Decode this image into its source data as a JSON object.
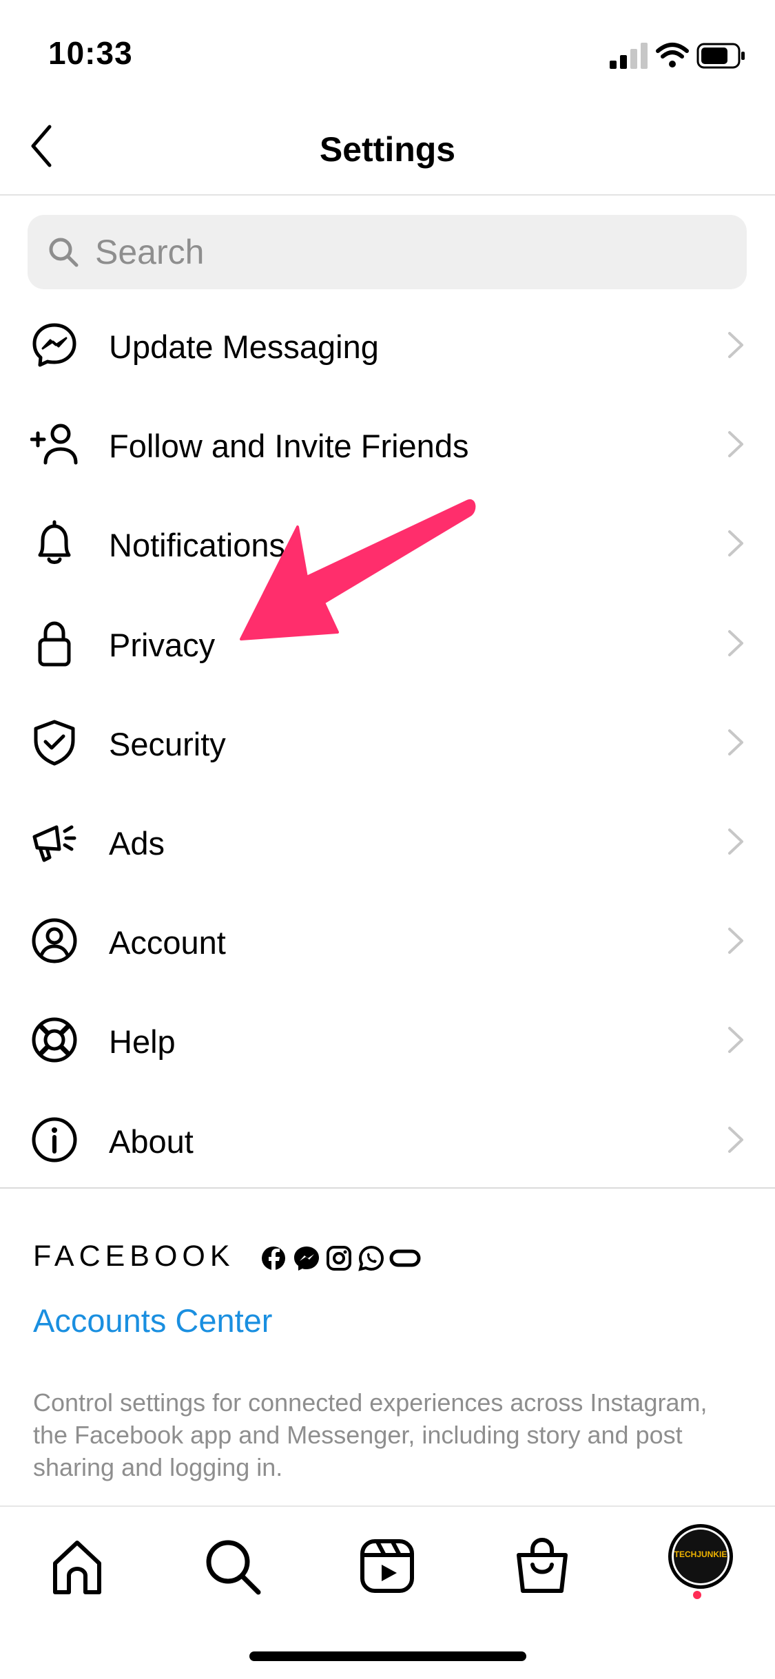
{
  "status": {
    "time": "10:33"
  },
  "header": {
    "title": "Settings"
  },
  "search": {
    "placeholder": "Search"
  },
  "menu": [
    {
      "label": "Update Messaging",
      "icon": "messenger-icon"
    },
    {
      "label": "Follow and Invite Friends",
      "icon": "add-person-icon"
    },
    {
      "label": "Notifications",
      "icon": "bell-icon"
    },
    {
      "label": "Privacy",
      "icon": "lock-icon"
    },
    {
      "label": "Security",
      "icon": "shield-check-icon"
    },
    {
      "label": "Ads",
      "icon": "megaphone-icon"
    },
    {
      "label": "Account",
      "icon": "user-circle-icon"
    },
    {
      "label": "Help",
      "icon": "lifebuoy-icon"
    },
    {
      "label": "About",
      "icon": "info-icon"
    }
  ],
  "facebook": {
    "brand": "FACEBOOK",
    "apps": [
      "facebook-icon",
      "messenger-icon",
      "instagram-icon",
      "whatsapp-icon",
      "oculus-icon"
    ],
    "accounts_center": "Accounts Center",
    "description": "Control settings for connected experiences across Instagram, the Facebook app and Messenger, including story and post sharing and logging in."
  },
  "tabs": [
    "home-icon",
    "search-icon",
    "reels-icon",
    "shop-icon",
    "profile-avatar"
  ],
  "avatar": {
    "text": "TECHJUNKIE"
  },
  "colors": {
    "accent_link": "#1a8fe0",
    "annotation_arrow": "#ff2e6c",
    "notification_dot": "#ff2c55"
  }
}
